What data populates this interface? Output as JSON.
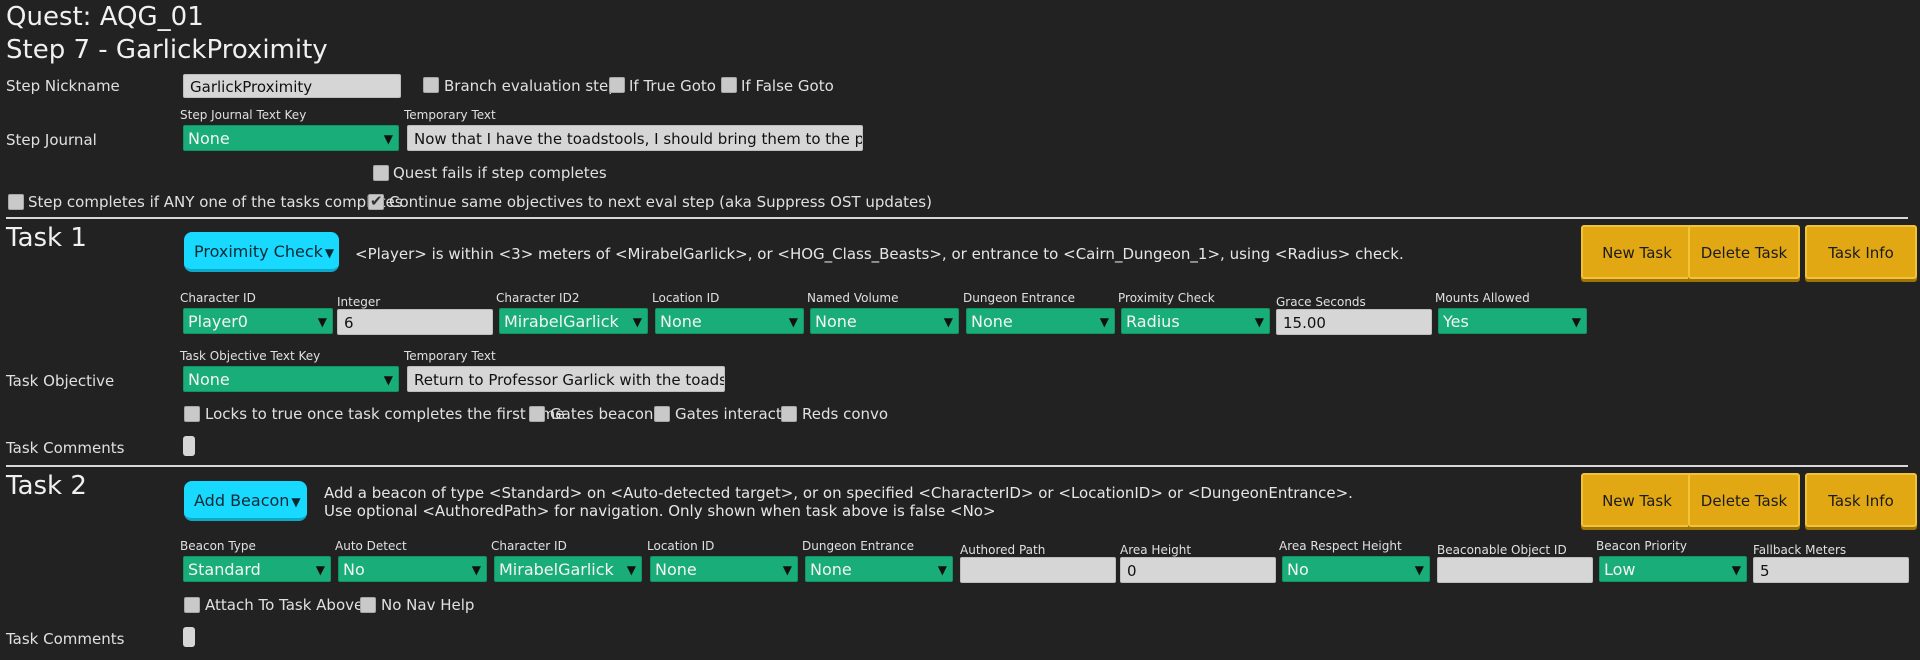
{
  "header": {
    "quest": "Quest: AQG_01",
    "step": "Step 7 - GarlickProximity"
  },
  "step": {
    "nickname_label": "Step Nickname",
    "nickname_value": "GarlickProximity",
    "branch_eval": {
      "label": "Branch evaluation step",
      "checked": false
    },
    "if_true_goto": {
      "label": "If True Goto",
      "checked": false
    },
    "if_false_goto": {
      "label": "If False Goto",
      "checked": false
    },
    "journal_label": "Step Journal",
    "journal_key_label": "Step Journal Text Key",
    "journal_key_value": "None",
    "temp_text_label": "Temporary Text",
    "temp_text_value": "Now that I have the toadstools, I should bring them to the professor.",
    "quest_fails": {
      "label": "Quest fails if step completes",
      "checked": false
    },
    "any_task": {
      "label": "Step completes if ANY one of the tasks completes",
      "checked": false
    },
    "continue_same": {
      "label": "Continue same objectives to next eval step (aka Suppress OST updates)",
      "checked": true
    }
  },
  "task1": {
    "title": "Task 1",
    "type_button": "Proximity Check",
    "description": "<Player> is within <3> meters of <MirabelGarlick>, or <HOG_Class_Beasts>, or entrance to <Cairn_Dungeon_1>, using <Radius> check.",
    "buttons": {
      "new": "New Task",
      "delete": "Delete Task",
      "info": "Task Info"
    },
    "fields": {
      "character_id": {
        "label": "Character ID",
        "value": "Player0"
      },
      "integer": {
        "label": "Integer",
        "value": "6"
      },
      "character_id2": {
        "label": "Character ID2",
        "value": "MirabelGarlick"
      },
      "location_id": {
        "label": "Location ID",
        "value": "None"
      },
      "named_volume": {
        "label": "Named Volume",
        "value": "None"
      },
      "dungeon_entrance": {
        "label": "Dungeon Entrance",
        "value": "None"
      },
      "proximity_check": {
        "label": "Proximity Check",
        "value": "Radius"
      },
      "grace_seconds": {
        "label": "Grace Seconds",
        "value": "15.00"
      },
      "mounts_allowed": {
        "label": "Mounts Allowed",
        "value": "Yes"
      }
    },
    "objective_label": "Task Objective",
    "objective_key_label": "Task Objective Text Key",
    "objective_key_value": "None",
    "temp_text_label": "Temporary Text",
    "temp_text_value": "Return to Professor Garlick with the toadstools",
    "locks": {
      "label": "Locks to true once task completes the first time",
      "checked": false
    },
    "gates_beacon": {
      "label": "Gates beacon",
      "checked": false
    },
    "gates_interact": {
      "label": "Gates interact",
      "checked": false
    },
    "reds_convo": {
      "label": "Reds convo",
      "checked": false
    },
    "comments_label": "Task Comments"
  },
  "task2": {
    "title": "Task 2",
    "type_button": "Add Beacon",
    "description_line1": "Add a beacon of type <Standard> on <Auto-detected target>, or on specified <CharacterID> or <LocationID> or <DungeonEntrance>.",
    "description_line2": "Use optional <AuthoredPath> for navigation. Only shown when task above is false <No>",
    "buttons": {
      "new": "New Task",
      "delete": "Delete Task",
      "info": "Task Info"
    },
    "fields": {
      "beacon_type": {
        "label": "Beacon Type",
        "value": "Standard"
      },
      "auto_detect": {
        "label": "Auto Detect",
        "value": "No"
      },
      "character_id": {
        "label": "Character ID",
        "value": "MirabelGarlick"
      },
      "location_id": {
        "label": "Location ID",
        "value": "None"
      },
      "dungeon_entrance": {
        "label": "Dungeon Entrance",
        "value": "None"
      },
      "authored_path": {
        "label": "Authored Path",
        "value": ""
      },
      "area_height": {
        "label": "Area Height",
        "value": "0"
      },
      "area_respect_height": {
        "label": "Area Respect Height",
        "value": "No"
      },
      "beaconable_object_id": {
        "label": "Beaconable Object ID",
        "value": ""
      },
      "beacon_priority": {
        "label": "Beacon Priority",
        "value": "Low"
      },
      "fallback_meters": {
        "label": "Fallback Meters",
        "value": "5"
      }
    },
    "attach_above": {
      "label": "Attach To Task Above",
      "checked": false
    },
    "no_nav_help": {
      "label": "No Nav Help",
      "checked": false
    },
    "comments_label": "Task Comments"
  },
  "colors": {
    "background": "#222222",
    "dropdown": "#19ad79",
    "type_button": "#18d9ff",
    "action_button": "#e2a814"
  }
}
